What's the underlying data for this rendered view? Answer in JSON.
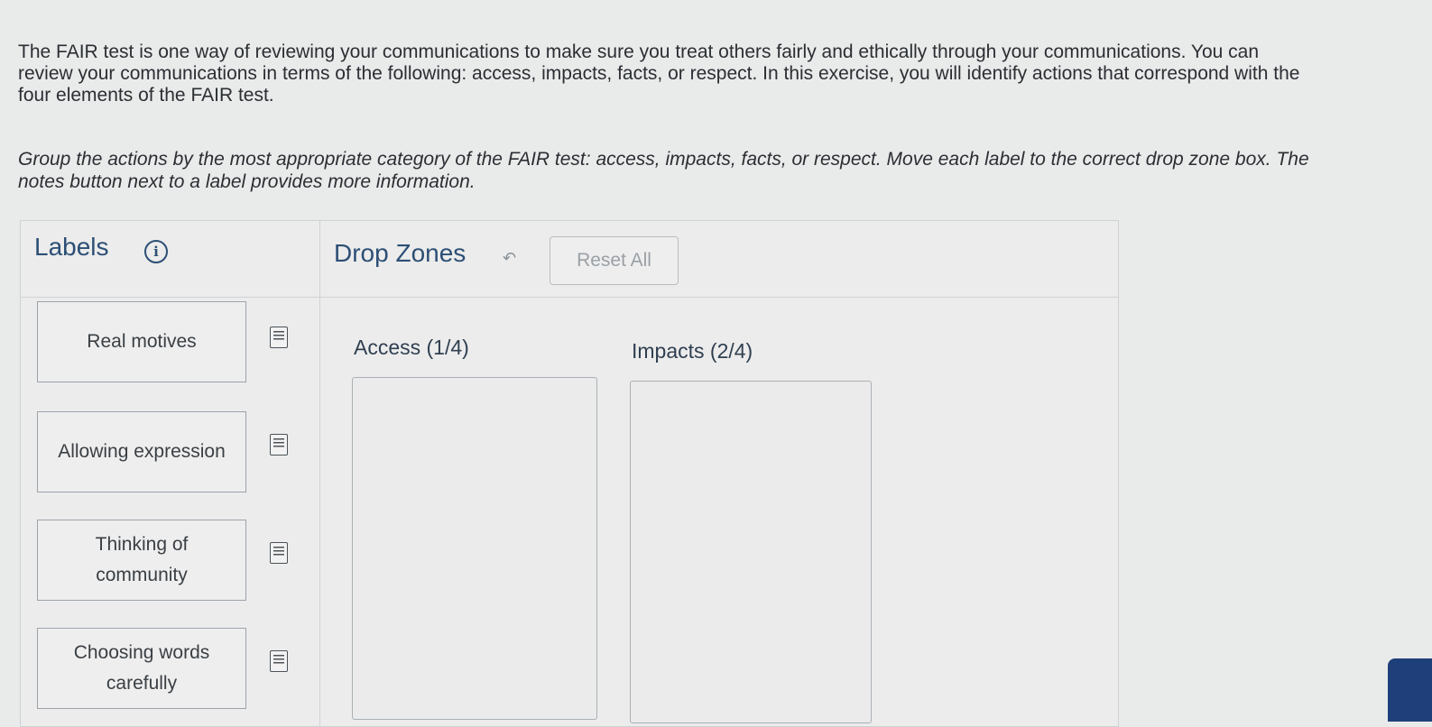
{
  "intro_text": "The FAIR test is one way of reviewing your communications to make sure you treat others fairly and ethically through your communications. You can review your communications in terms of the following: access, impacts, facts, or respect. In this exercise, you will identify actions that correspond with the four elements of the FAIR test.",
  "instructions": "Group the actions by the most appropriate category of the FAIR test: access, impacts, facts, or respect. Move each label to the correct drop zone box. The notes button next to a label provides more information.",
  "labels_panel": {
    "heading": "Labels",
    "info_icon": "info-circle-icon",
    "items": [
      {
        "text": "Real motives"
      },
      {
        "text": "Allowing expression"
      },
      {
        "text": "Thinking of community"
      },
      {
        "text": "Choosing words carefully"
      }
    ],
    "note_icon": "notes-icon"
  },
  "drop_zones_panel": {
    "heading": "Drop Zones",
    "undo_icon": "undo-arrow-icon",
    "reset_label": "Reset All",
    "zones": [
      {
        "title": "Access (1/4)"
      },
      {
        "title": "Impacts (2/4)"
      }
    ]
  },
  "colors": {
    "heading": "#2c4f75",
    "background": "#e9eaea",
    "side_tab": "#1e3f7a"
  }
}
